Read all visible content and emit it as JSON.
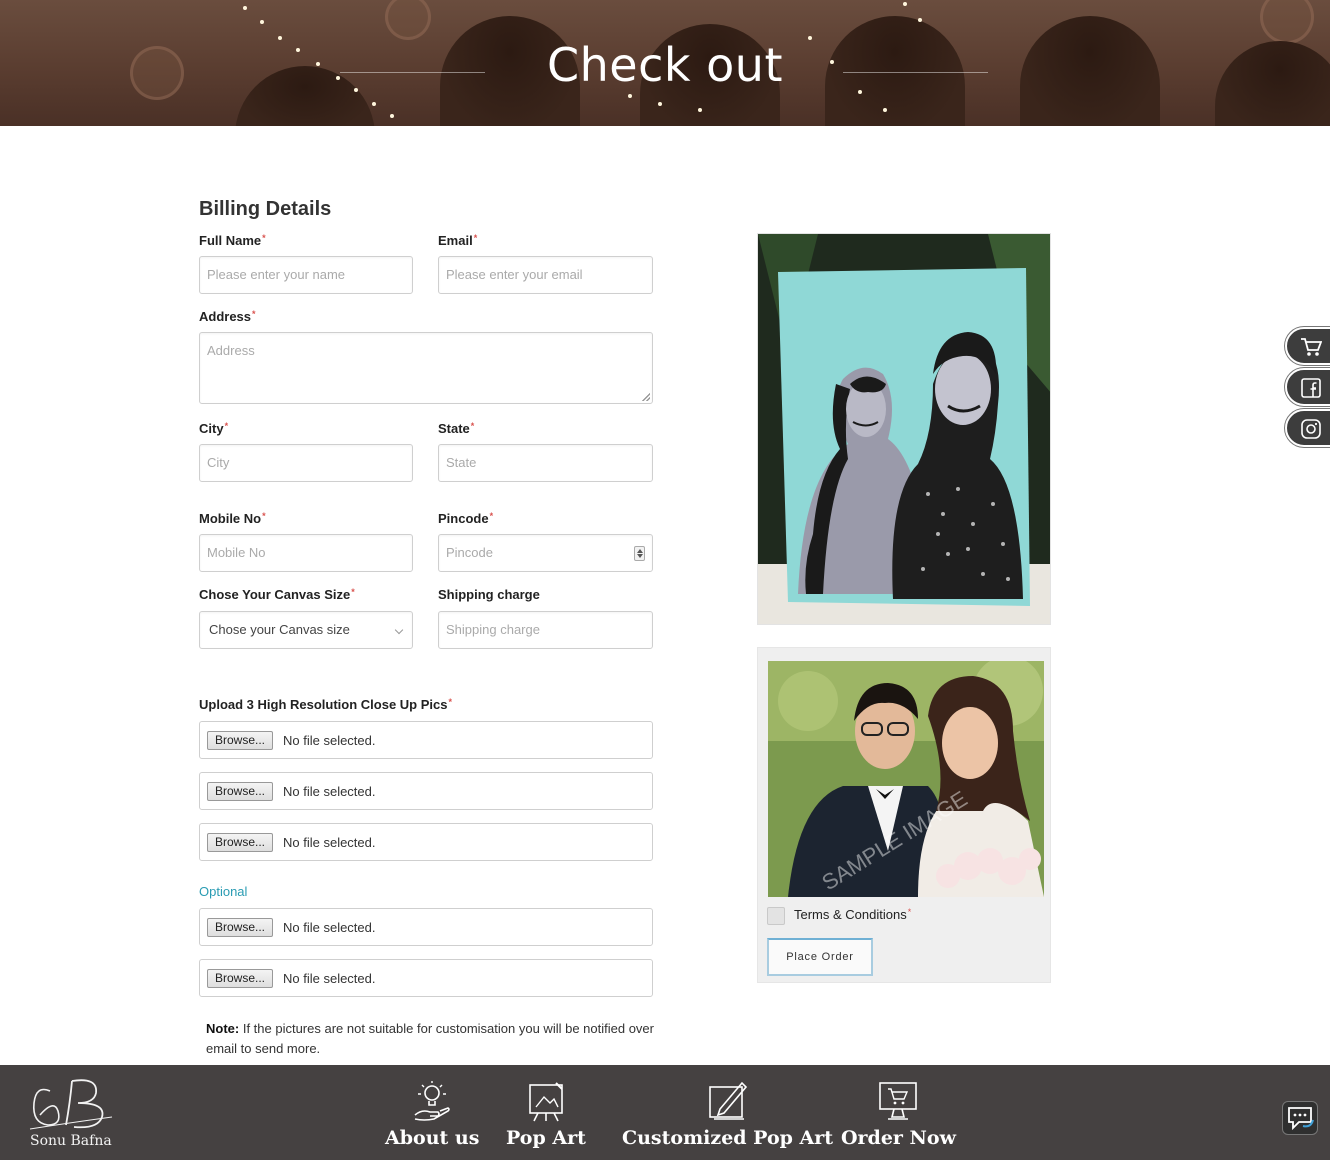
{
  "hero": {
    "title": "Check out"
  },
  "form": {
    "title": "Billing Details",
    "full_name": {
      "label": "Full Name",
      "placeholder": "Please enter your name"
    },
    "email": {
      "label": "Email",
      "placeholder": "Please enter your email"
    },
    "address": {
      "label": "Address",
      "placeholder": "Address"
    },
    "city": {
      "label": "City",
      "placeholder": "City"
    },
    "state": {
      "label": "State",
      "placeholder": "State"
    },
    "mobile": {
      "label": "Mobile No",
      "placeholder": "Mobile No"
    },
    "pincode": {
      "label": "Pincode",
      "placeholder": "Pincode"
    },
    "canvas_size": {
      "label": "Chose Your Canvas Size",
      "selected": "Chose your Canvas size"
    },
    "shipping": {
      "label": "Shipping charge",
      "placeholder": "Shipping charge"
    },
    "upload": {
      "label": "Upload 3 High Resolution Close Up Pics",
      "browse_label": "Browse...",
      "status": "No file selected.",
      "optional_label": "Optional"
    },
    "note": {
      "bold": "Note:",
      "text": " If the pictures are not suitable for customisation you will be notified over email to send more."
    }
  },
  "order": {
    "watermark": "SAMPLE IMAGE",
    "terms_label": "Terms & Conditions",
    "place_order": "Place Order"
  },
  "side_social": [
    {
      "icon": "cart-icon"
    },
    {
      "icon": "facebook-icon"
    },
    {
      "icon": "instagram-icon"
    }
  ],
  "footer": {
    "logo_text": "Sonu Bafna",
    "nav": [
      {
        "label": "About us",
        "icon": "idea-hand-icon"
      },
      {
        "label": "Pop Art",
        "icon": "easel-icon"
      },
      {
        "label": "Customized Pop Art",
        "icon": "canvas-edit-icon"
      },
      {
        "label": "Order Now",
        "icon": "monitor-cart-icon"
      }
    ],
    "chat_icon": "chat-icon"
  },
  "colors": {
    "footer_bg": "#454141",
    "required_star": "#d9534f",
    "optional_text": "#2a9cb3",
    "pop_art_bg": "#8fd8d6"
  }
}
